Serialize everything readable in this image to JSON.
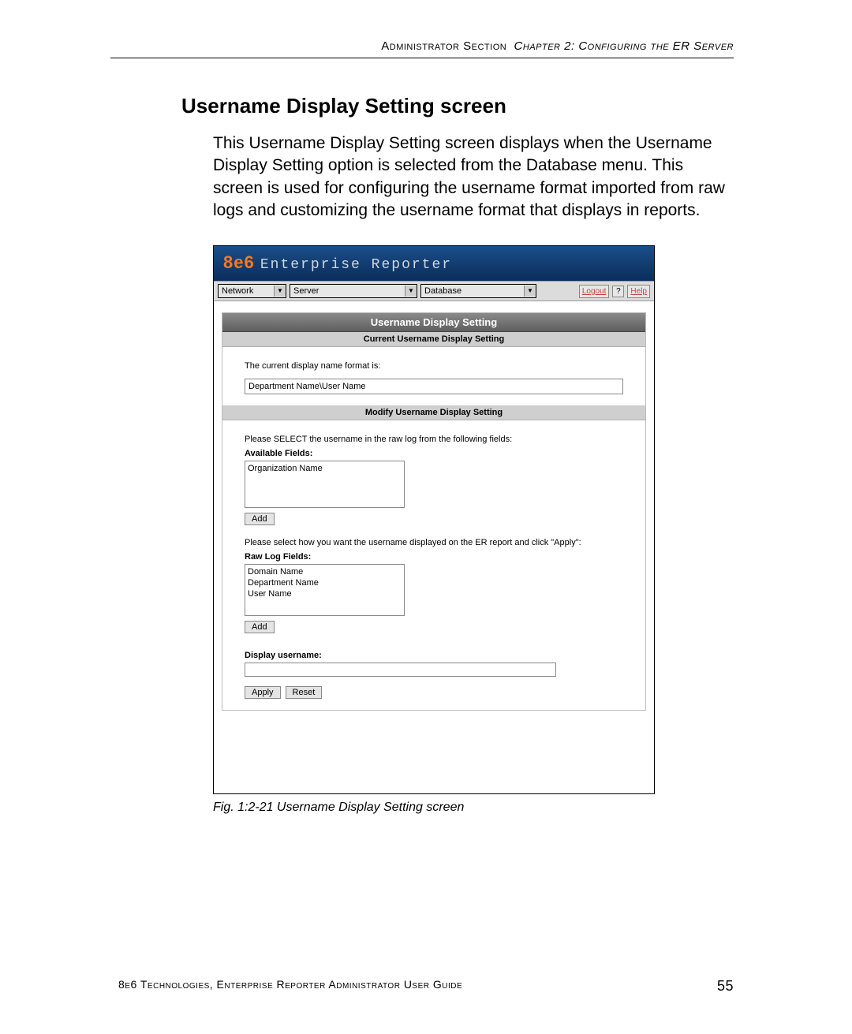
{
  "header": {
    "section": "Administrator Section",
    "chapter": "Chapter 2: Configuring the ER Server"
  },
  "heading": "Username Display Setting screen",
  "paragraph": "This Username Display Setting screen displays when the Username Display Setting option is selected from the Database menu. This screen is used for configuring the username format imported from raw logs and customizing the username format that displays in reports.",
  "figure": {
    "caption": "Fig. 1:2-21 Username Display Setting screen"
  },
  "app": {
    "logo": "8e6",
    "product": "Enterprise Reporter",
    "menus": {
      "network": "Network",
      "server": "Server",
      "database": "Database"
    },
    "links": {
      "logout": "Logout",
      "help": "Help",
      "q": "?"
    },
    "panel": {
      "title": "Username Display Setting",
      "current": {
        "subheader": "Current Username Display Setting",
        "label": "The current display name format is:",
        "value": "Department Name\\User Name"
      },
      "modify": {
        "subheader": "Modify Username Display Setting",
        "select_prompt": "Please SELECT the username in the raw log from the following fields:",
        "available_label": "Available Fields:",
        "available_items": [
          "Organization Name"
        ],
        "add_btn": "Add",
        "display_prompt": "Please select how you want the username displayed on the ER report and click \"Apply\":",
        "raw_label": "Raw Log Fields:",
        "raw_items": [
          "Domain Name",
          "Department Name",
          "User Name"
        ],
        "add_btn2": "Add",
        "display_label": "Display username:",
        "apply_btn": "Apply",
        "reset_btn": "Reset"
      }
    }
  },
  "footer": {
    "text": "8e6 Technologies, Enterprise Reporter Administrator User Guide",
    "page": "55"
  }
}
